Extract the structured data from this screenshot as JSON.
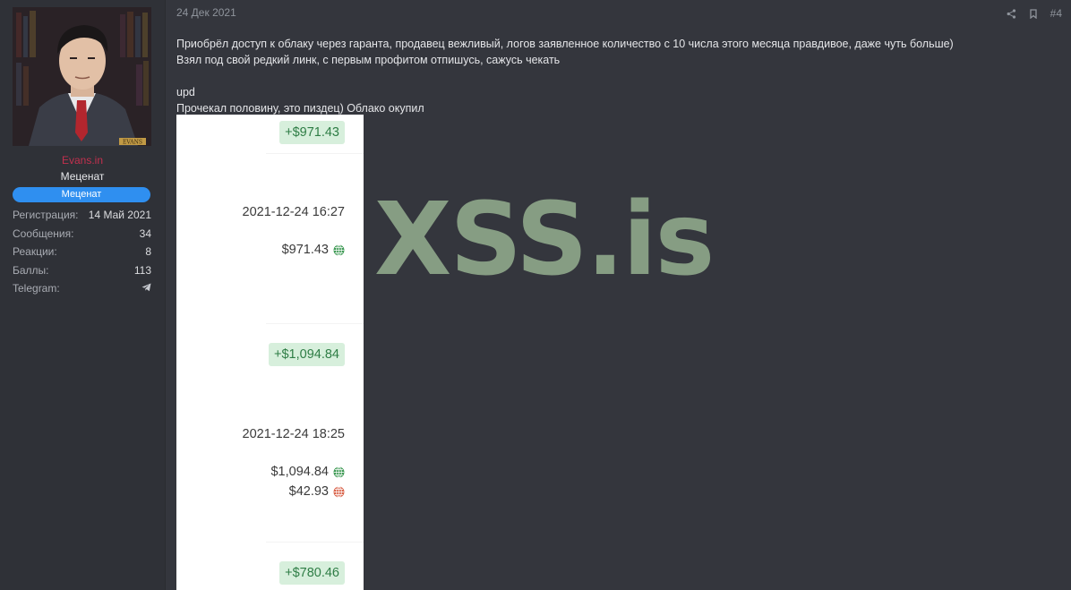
{
  "sidebar": {
    "username": "Evans.in",
    "user_title": "Меценат",
    "banner": "Меценат",
    "stats": [
      {
        "key": "Регистрация:",
        "value": "14 Май 2021"
      },
      {
        "key": "Сообщения:",
        "value": "34"
      },
      {
        "key": "Реакции:",
        "value": "8"
      },
      {
        "key": "Баллы:",
        "value": "113"
      },
      {
        "key": "Telegram:",
        "icon": "telegram-icon"
      }
    ],
    "avatar_caption": "EVANS"
  },
  "post": {
    "date": "24 Дек 2021",
    "number": "#4",
    "lines": [
      "Приобрёл доступ к облаку через гаранта, продавец вежливый, логов заявленное количество с 10 числа этого месяца правдивое, даже чуть больше)",
      "Взял под свой редкий линк, с первым профитом отпишусь, сажусь чекать",
      "upd",
      "Прочекал половину, это пиздец) Облако окупил"
    ]
  },
  "screenshot": {
    "pills": [
      "+$971.43",
      "+$1,094.84",
      "+$780.46"
    ],
    "timestamps": [
      "2021-12-24 16:27",
      "2021-12-24 18:25"
    ],
    "amounts": [
      {
        "text": "$971.43",
        "icon": "globe-green-icon"
      },
      {
        "text": "$1,094.84",
        "icon": "globe-green-icon"
      },
      {
        "text": "$42.93",
        "icon": "globe-red-icon"
      }
    ],
    "colors": {
      "pill_bg": "#d7efdc",
      "pill_text": "#2e7d45",
      "globe_green": "#3f9a55",
      "globe_red": "#d9634a"
    }
  },
  "watermark": "XSS.is",
  "colors": {
    "background": "#34363d",
    "sidebar": "#2f3137",
    "username": "#c2304e",
    "banner": "#2f8ff0",
    "watermark": "#869d83"
  }
}
